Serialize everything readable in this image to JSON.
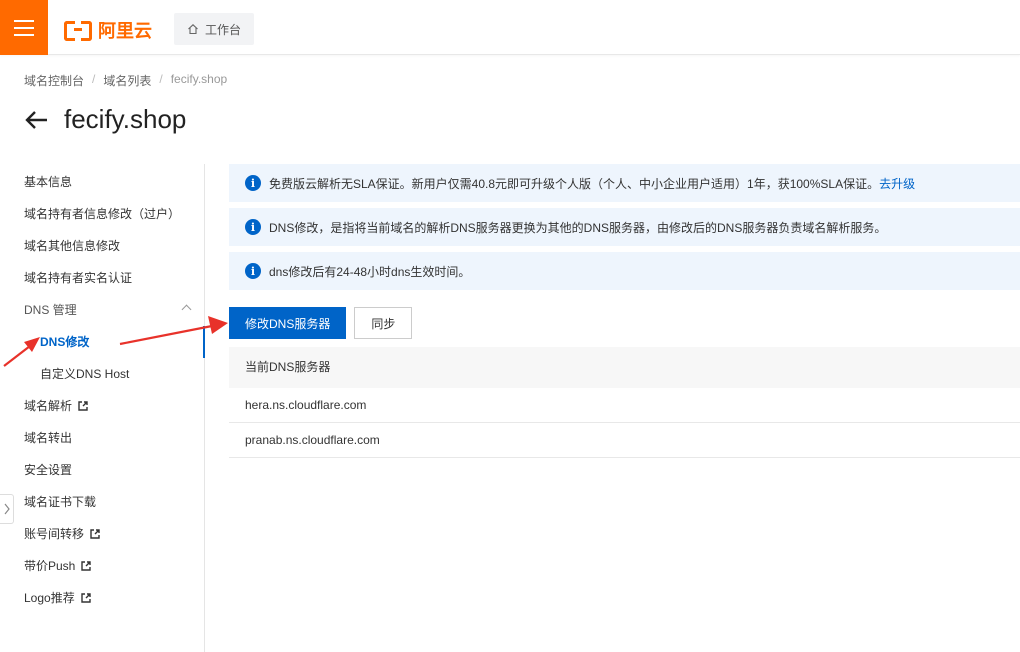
{
  "header": {
    "brand": "阿里云",
    "workbench_label": "工作台",
    "accent_color": "#ff6a00"
  },
  "breadcrumb": [
    "域名控制台",
    "域名列表",
    "fecify.shop"
  ],
  "page": {
    "title": "fecify.shop"
  },
  "sidebar": {
    "items": [
      {
        "label": "基本信息"
      },
      {
        "label": "域名持有者信息修改（过户）"
      },
      {
        "label": "域名其他信息修改"
      },
      {
        "label": "域名持有者实名认证"
      },
      {
        "label": "DNS 管理"
      },
      {
        "label": "DNS修改"
      },
      {
        "label": "自定义DNS Host"
      },
      {
        "label": "域名解析"
      },
      {
        "label": "域名转出"
      },
      {
        "label": "安全设置"
      },
      {
        "label": "域名证书下载"
      },
      {
        "label": "账号间转移"
      },
      {
        "label": "带价Push"
      },
      {
        "label": "Logo推荐"
      }
    ]
  },
  "notices": [
    {
      "text": "免费版云解析无SLA保证。新用户仅需40.8元即可升级个人版（个人、中小企业用户适用）1年，获100%SLA保证。",
      "link": "去升级"
    },
    {
      "text": "DNS修改，是指将当前域名的解析DNS服务器更换为其他的DNS服务器，由修改后的DNS服务器负责域名解析服务。"
    },
    {
      "text": "dns修改后有24-48小时dns生效时间。"
    }
  ],
  "buttons": {
    "modify": "修改DNS服务器",
    "sync": "同步"
  },
  "dns_table": {
    "header": "当前DNS服务器",
    "rows": [
      "hera.ns.cloudflare.com",
      "pranab.ns.cloudflare.com"
    ]
  },
  "colors": {
    "primary": "#0064c8",
    "annotation": "#e8322a"
  }
}
